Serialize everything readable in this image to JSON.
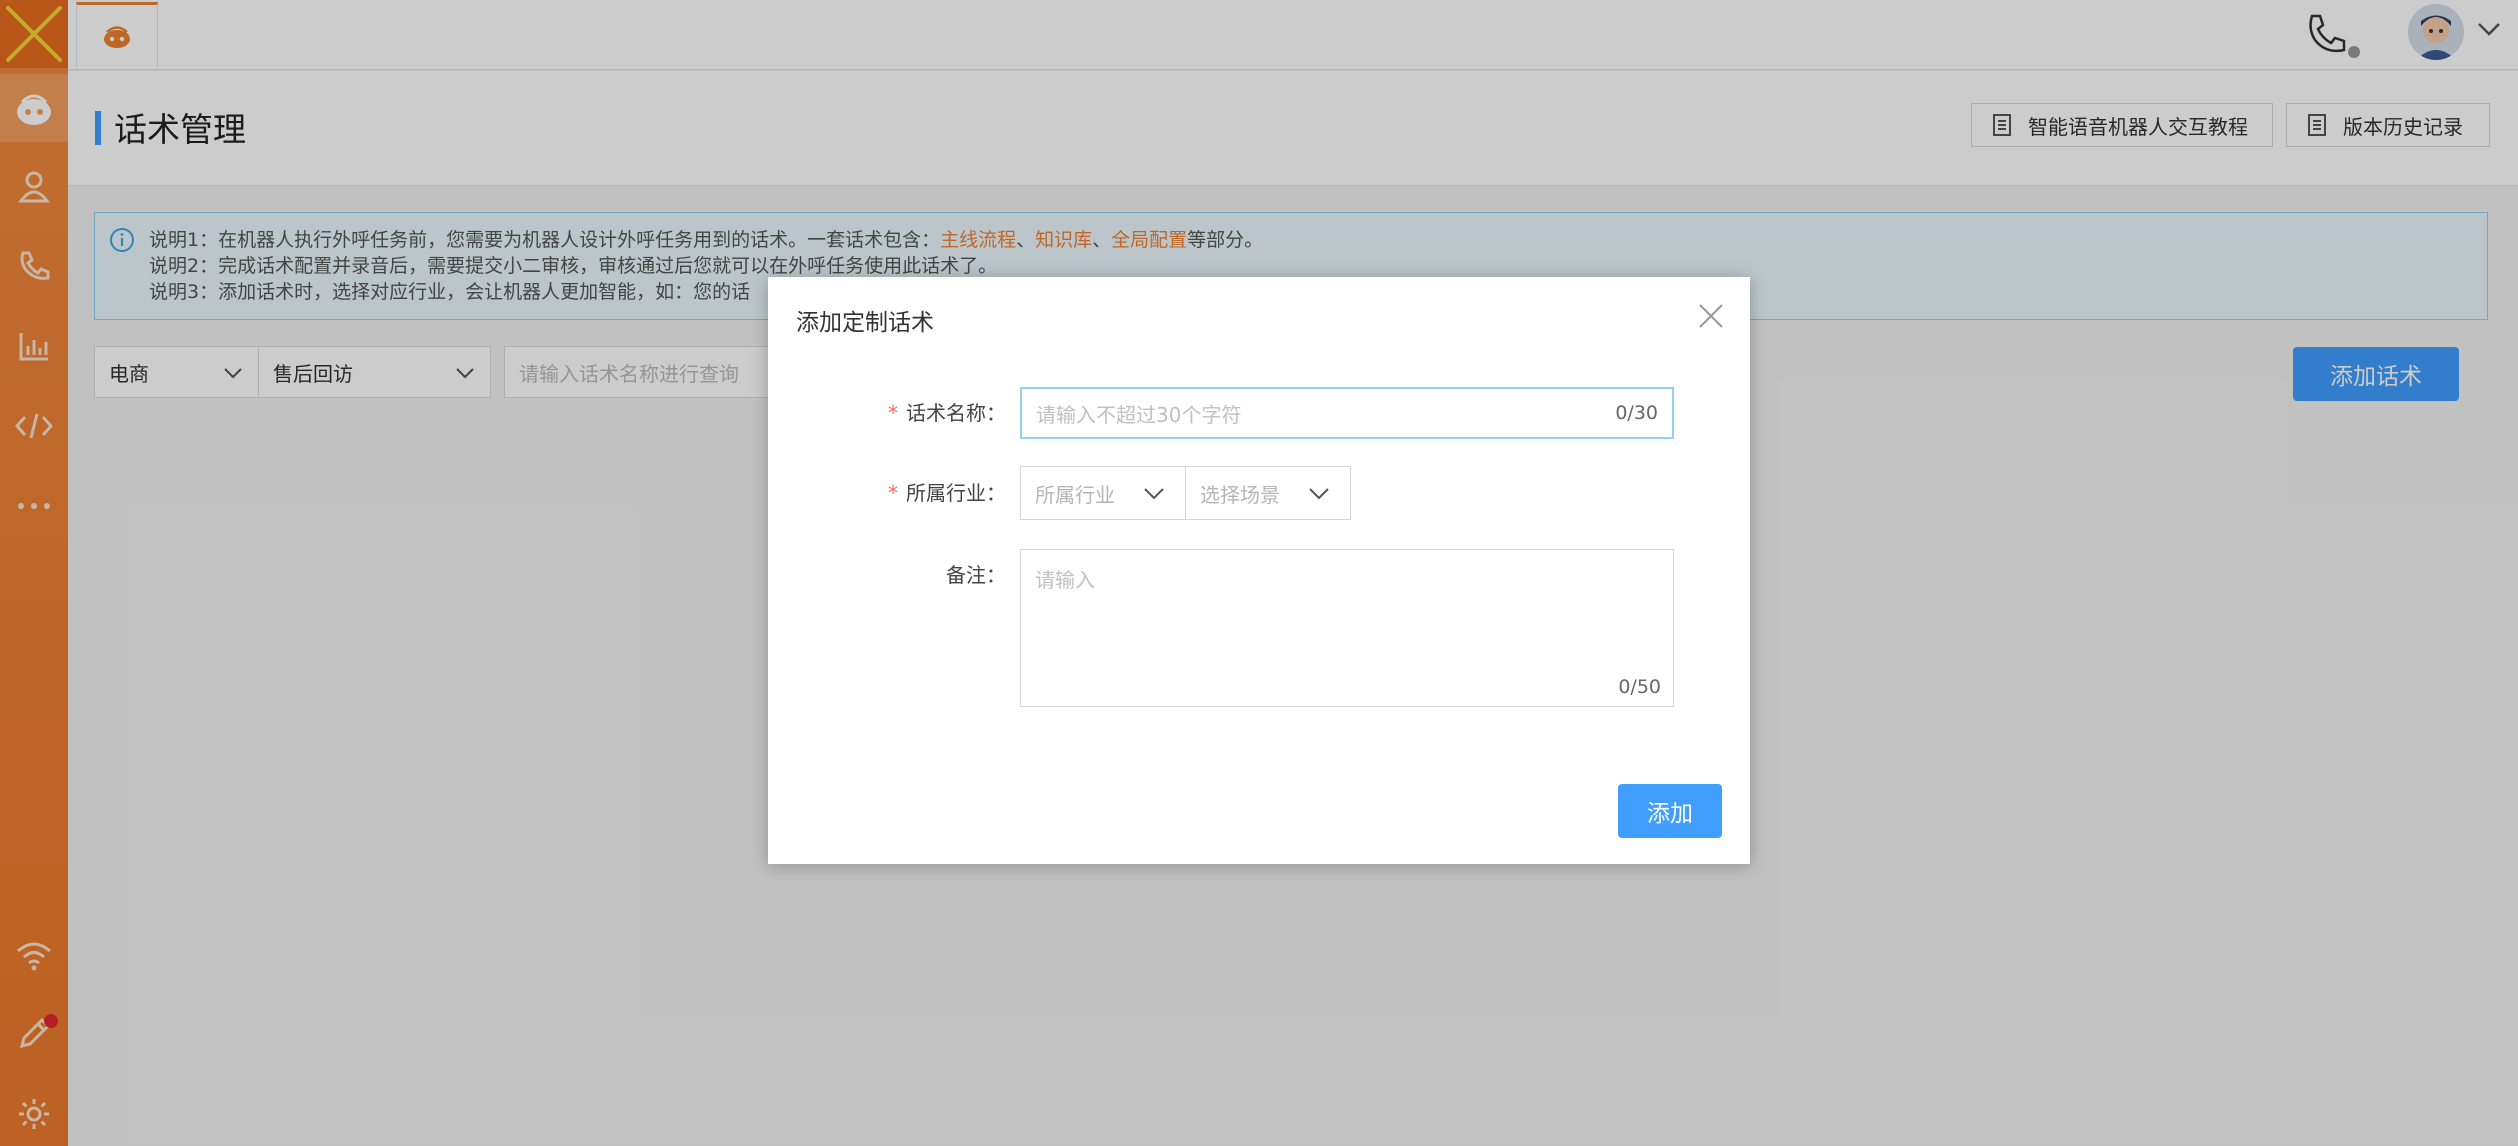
{
  "sidebar": {
    "items": [
      {
        "name": "robot-icon"
      },
      {
        "name": "contacts-icon"
      },
      {
        "name": "call-icon"
      },
      {
        "name": "report-chart-icon"
      },
      {
        "name": "code-icon"
      },
      {
        "name": "more-icon"
      }
    ],
    "bottom": [
      {
        "name": "wifi-icon"
      },
      {
        "name": "pencil-icon"
      },
      {
        "name": "gear-icon"
      }
    ]
  },
  "header": {
    "title": "话术管理",
    "tutorial_button": "智能语音机器人交互教程",
    "history_button": "版本历史记录"
  },
  "info": {
    "line1_prefix": "说明1：在机器人执行外呼任务前，您需要为机器人设计外呼任务用到的话术。一套话术包含：",
    "line1_hl1": "主线流程",
    "line1_sep1": "、",
    "line1_hl2": "知识库",
    "line1_sep2": "、",
    "line1_hl3": "全局配置",
    "line1_suffix": "等部分。",
    "line2": "说明2：完成话术配置并录音后，需要提交小二审核，审核通过后您就可以在外呼任务使用此话术了。",
    "line3": "说明3：添加话术时，选择对应行业，会让机器人更加智能，如：您的话"
  },
  "filters": {
    "industry": "电商",
    "scene": "售后回访",
    "search_placeholder": "请输入话术名称进行查询",
    "add_button": "添加话术"
  },
  "dialog": {
    "title": "添加定制话术",
    "name_label": "话术名称：",
    "name_placeholder": "请输入不超过30个字符",
    "name_counter": "0/30",
    "industry_label": "所属行业：",
    "industry_placeholder": "所属行业",
    "scene_placeholder": "选择场景",
    "remark_label": "备注：",
    "remark_placeholder": "请输入",
    "remark_counter": "0/50",
    "submit": "添加",
    "required_mark": "*"
  },
  "colors": {
    "sidebar": "#ee8133",
    "primary": "#409eff",
    "highlight": "#ee8133",
    "required": "#f56c6c"
  }
}
